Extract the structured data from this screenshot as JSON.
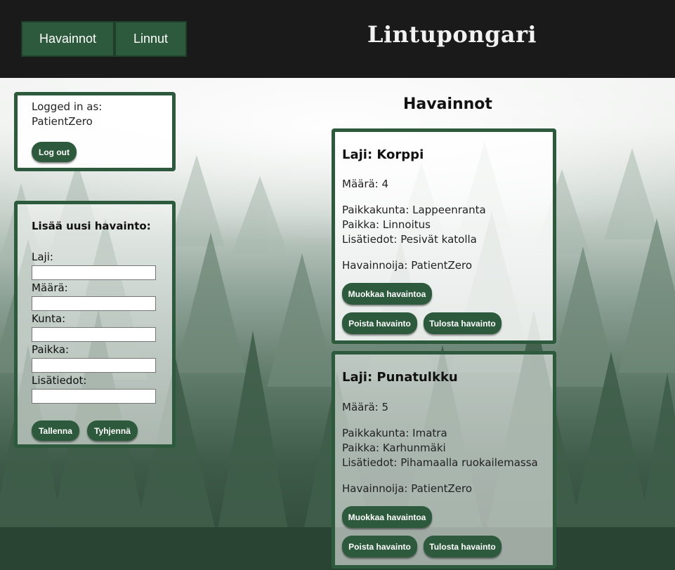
{
  "header": {
    "nav": [
      {
        "label": "Havainnot"
      },
      {
        "label": "Linnut"
      }
    ],
    "title": "Lintupongari"
  },
  "login": {
    "label": "Logged in as:",
    "username": "PatientZero",
    "logout_label": "Log out"
  },
  "add_form": {
    "title": "Lisää uusi havainto:",
    "fields": [
      {
        "label": "Laji:",
        "value": ""
      },
      {
        "label": "Määrä:",
        "value": ""
      },
      {
        "label": "Kunta:",
        "value": ""
      },
      {
        "label": "Paikka:",
        "value": ""
      },
      {
        "label": "Lisätiedot:",
        "value": ""
      }
    ],
    "save_label": "Tallenna",
    "clear_label": "Tyhjennä"
  },
  "main": {
    "heading": "Havainnot",
    "observations": [
      {
        "species": "Laji: Korppi",
        "count": "Määrä: 4",
        "municipality": "Paikkakunta: Lappeenranta",
        "place": "Paikka: Linnoitus",
        "notes": "Lisätiedot: Pesivät katolla",
        "observer": "Havainnoija: PatientZero",
        "edit_label": "Muokkaa havaintoa",
        "delete_label": "Poista havainto",
        "print_label": "Tulosta havainto"
      },
      {
        "species": "Laji: Punatulkku",
        "count": "Määrä: 5",
        "municipality": "Paikkakunta: Imatra",
        "place": "Paikka: Karhunmäki",
        "notes": "Lisätiedot: Pihamaalla ruokailemassa",
        "observer": "Havainnoija: PatientZero",
        "edit_label": "Muokkaa havaintoa",
        "delete_label": "Poista havainto",
        "print_label": "Tulosta havainto"
      }
    ]
  },
  "colors": {
    "accent": "#2d5a3d",
    "header_bg": "#1a1a1a"
  }
}
